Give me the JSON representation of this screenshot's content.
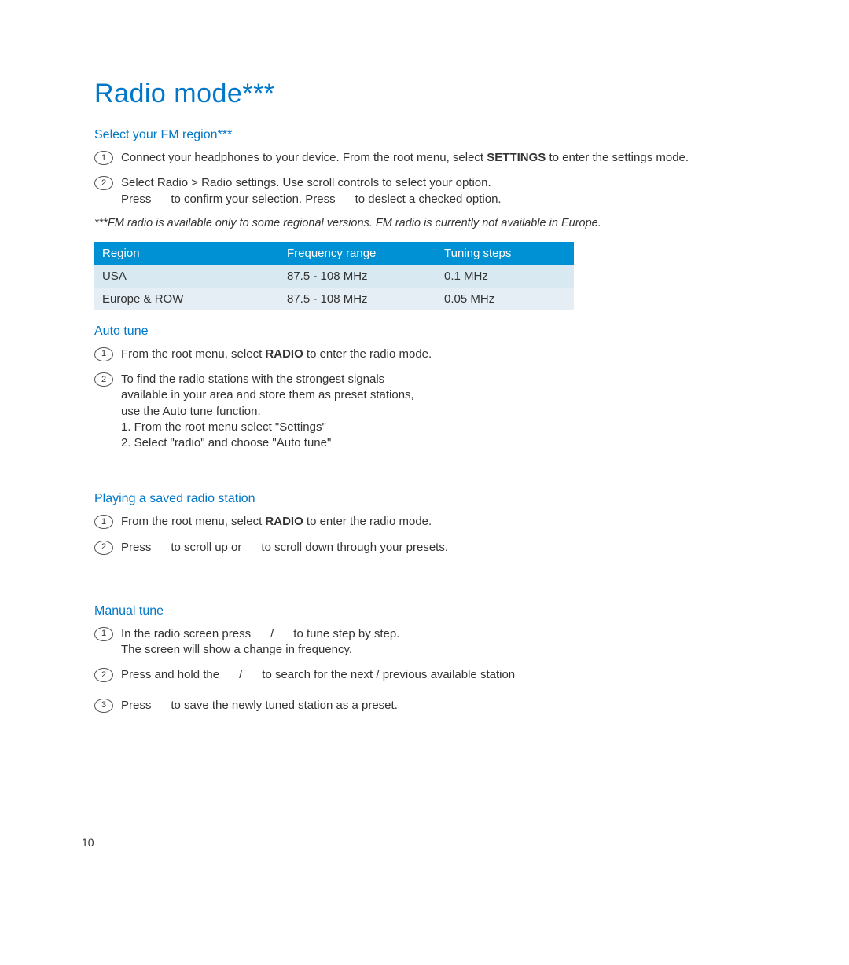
{
  "title": "Radio mode***",
  "section_fm_region": {
    "heading": "Select your FM region***",
    "steps": [
      {
        "num": "1",
        "pre": "Connect your headphones to your device. From the root menu, select ",
        "bold": "SETTINGS",
        "post": " to enter the settings mode."
      },
      {
        "num": "2",
        "line1": "Select Radio > Radio settings.  Use scroll controls to select your option.",
        "line2a": "Press ",
        "line2b": " to confirm your selection. Press ",
        "line2c": " to deslect a checked option."
      }
    ],
    "note": "***FM radio is available only to some regional versions. FM radio is currently not available in Europe."
  },
  "table": {
    "headers": [
      "Region",
      "Frequency range",
      "Tuning steps"
    ],
    "rows": [
      [
        "USA",
        "87.5 - 108 MHz",
        "0.1 MHz"
      ],
      [
        "Europe & ROW",
        "87.5 - 108 MHz",
        "0.05 MHz"
      ]
    ]
  },
  "section_auto_tune": {
    "heading": "Auto tune",
    "steps": [
      {
        "num": "1",
        "pre": "From the root menu, select ",
        "bold": "RADIO",
        "post": " to enter the radio mode."
      },
      {
        "num": "2",
        "l1": "To find the radio stations with the strongest signals",
        "l2": "available in your area and store them as preset stations,",
        "l3": "use the Auto tune function.",
        "l4": "1. From the root menu select \"Settings\"",
        "l5": "2. Select \"radio\" and choose \"Auto tune\""
      }
    ]
  },
  "section_playing": {
    "heading": "Playing a saved radio station",
    "steps": [
      {
        "num": "1",
        "pre": "From the root menu, select ",
        "bold": "RADIO",
        "post": " to enter the radio mode."
      },
      {
        "num": "2",
        "a": "Press ",
        "b": " to scroll up or ",
        "c": " to scroll down through your presets."
      }
    ]
  },
  "section_manual": {
    "heading": "Manual tune",
    "steps": [
      {
        "num": "1",
        "a": "In the radio screen press ",
        "b": " / ",
        "c": " to tune step by step.",
        "d": "The screen will show a change in frequency."
      },
      {
        "num": "2",
        "a": "Press and hold the ",
        "b": " / ",
        "c": " to search for the next / previous available station"
      },
      {
        "num": "3",
        "a": "Press ",
        "b": " to save the newly tuned station as a preset."
      }
    ]
  },
  "page_number": "10"
}
